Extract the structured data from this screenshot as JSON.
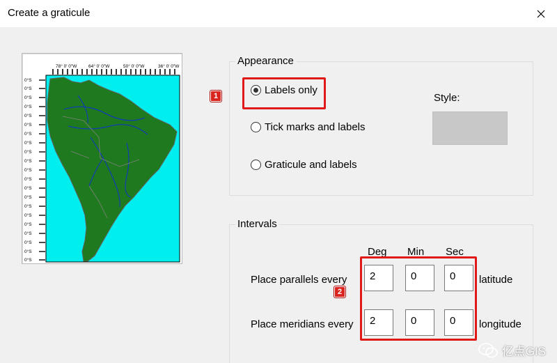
{
  "window": {
    "title": "Create a graticule"
  },
  "preview": {
    "top_labels": [
      "78° 0' 0\"W",
      "64° 0' 0\"W",
      "50° 0' 0\"W",
      "36° 0' 0\"W"
    ],
    "side_label": "0°S",
    "colors": {
      "ocean": "#00eeee",
      "land": "#1f7a1f",
      "rivers": "#1030d0",
      "borders": "#808080"
    }
  },
  "appearance": {
    "group_label": "Appearance",
    "options": [
      {
        "label": "Labels only",
        "selected": true
      },
      {
        "label": "Tick marks and labels",
        "selected": false
      },
      {
        "label": "Graticule and labels",
        "selected": false
      }
    ],
    "style_label": "Style:"
  },
  "intervals": {
    "group_label": "Intervals",
    "columns": [
      "Deg",
      "Min",
      "Sec"
    ],
    "parallels": {
      "label": "Place parallels every",
      "values": [
        "2",
        "0",
        "0"
      ],
      "suffix": "latitude"
    },
    "meridians": {
      "label": "Place meridians every",
      "values": [
        "2",
        "0",
        "0"
      ],
      "suffix": "longitude"
    }
  },
  "annotations": {
    "badge_1": "1",
    "badge_2": "2",
    "highlight_color": "#e01818"
  },
  "watermark": {
    "text": "亿点GIS"
  }
}
